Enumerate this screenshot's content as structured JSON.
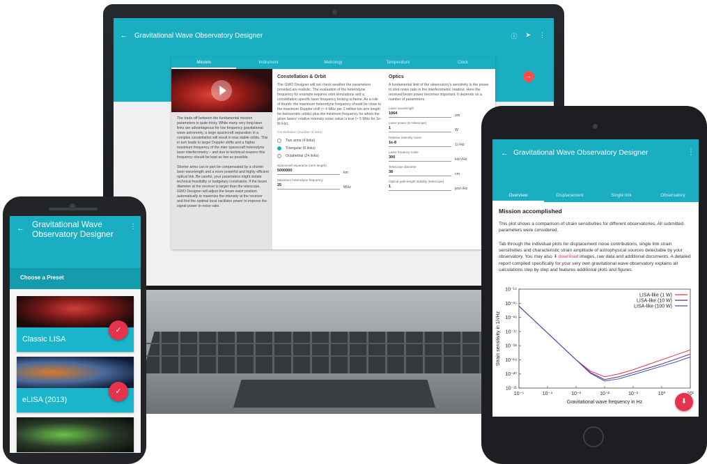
{
  "app": {
    "title": "Gravitational Wave Observatory Designer"
  },
  "laptop": {
    "tabs": [
      "Mission",
      "Instrument",
      "Metrology",
      "Temperature",
      "Clock"
    ],
    "active_tab": "Mission",
    "left_text": "The trade-off between the fundamental mission parameters is quite tricky. While many very long laser links are advantageous for low frequency gravitational wave astronomy, a large spacecraft separation in a complex constellation will result in less stable orbits. This in turn leads to larger Doppler shifts and a higher maximum frequency of the inter spacecraft heterodyne laser interferometry – and due to technical reasons this frequency should be kept as low as possible.\n\nShorter arms can in part be compensated by a shorter laser wavelength and a more powerful and highly efficient optical link. Be careful, your parameters might violate technical feasibility or budgetary constraints. If the beam diameter at the receiver is larger than the telescope, GWO Designer will adjust the beam waist position automatically to maximize the intensity at the receiver and find the optimal local oscillator power to improve the signal power to noise ratio.",
    "constellation": {
      "heading": "Constellation & Orbit",
      "text": "The GWO Designer will not check weather the parameters provided are realistic. The evaluation of the heterodyne frequency for example requires orbit simulations and a constellation specific laser frequency locking scheme. As a rule of thumb: the maximum heterodyne frequency should be close to the maximum Doppler shift (≈ 4 MHz per 1 million km arm length for heliocentric orbits) plus the minimum frequency for which the given lasers' relative intensity noise value is true (≈ 5 MHz for 1e-8/√Hz).",
      "options_label": "Constellation (number of links)",
      "options": [
        "Two arms (4 links)",
        "Triangular (6 links)",
        "Octahedral (24 links)"
      ],
      "selected": "Triangular (6 links)",
      "fields": [
        {
          "label": "Spacecraft separation (arm length)",
          "value": "5000000",
          "unit": "km"
        },
        {
          "label": "Maximum heterodyne frequency",
          "value": "25",
          "unit": "MHz"
        }
      ]
    },
    "optics": {
      "heading": "Optics",
      "text": "A fundamental limit of the observatory's sensitivity is the power to shot noise ratio in the interferometric readout. Here the received beam power becomes important. It depends on a number of parameters.",
      "fields": [
        {
          "label": "Laser wavelength",
          "value": "1064",
          "unit": "nm"
        },
        {
          "label": "Laser power (to telescope)",
          "value": "1",
          "unit": "W"
        },
        {
          "label": "Relative intensity noise",
          "value": "1e-8",
          "unit": "1/√Hz"
        },
        {
          "label": "Laser freuency noise",
          "value": "300",
          "unit": "Hz/√Hz"
        },
        {
          "label": "Telescope diameter",
          "value": "38",
          "unit": "cm"
        },
        {
          "label": "Optical path-length stability (telescope)",
          "value": "1",
          "unit": "pm/√Hz"
        }
      ]
    },
    "icons": {
      "back": "arrow-left-icon",
      "info": "info-icon",
      "share": "share-icon",
      "menu": "more-vert-icon",
      "next": "arrow-right-icon"
    }
  },
  "phone": {
    "title": "Gravitational Wave Observatory Designer",
    "section": "Choose a Preset",
    "presets": [
      "Classic LISA",
      "eLISA (2013)"
    ]
  },
  "tablet": {
    "tabs": [
      "Overview",
      "Displacement",
      "Single link",
      "Observatory"
    ],
    "active_tab": "Overview",
    "heading": "Mission accomplished",
    "para1": "This plot shows a comparison of strain sensitivities for different observatories. All submitted parameters were considered.",
    "para2_a": "Tab through the individual plots for displacement noise contributions, single link strain sensitivities and characteristic strain amplitude of astrophysical sources detectable by your observatory. You may also ",
    "para2_link": "⬇ download",
    "para2_b": " images, raw data and additional documents. A detailed report compiled specifically for your very own gravitational wave observatory explains all calculations step by step and features additional plots and figures."
  },
  "chart_data": {
    "type": "line",
    "xlabel": "Gravitational wave frequency in Hz",
    "ylabel": "Strain sensitivity in 1/√Hz",
    "x_scale": "log",
    "y_scale": "log",
    "xlim_exp": [
      -5,
      1
    ],
    "ylim_exp": [
      -21,
      -14
    ],
    "x_tick_labels": [
      "10⁻⁵",
      "10⁻⁴",
      "10⁻³",
      "10⁻²",
      "10⁻¹",
      "10⁰",
      "10¹"
    ],
    "y_tick_labels": [
      "10⁻²¹",
      "10⁻²⁰",
      "10⁻¹⁹",
      "10⁻¹⁸",
      "10⁻¹⁷",
      "10⁻¹⁶",
      "10⁻¹⁵",
      "10⁻¹⁴"
    ],
    "legend_position": "top-right",
    "x_log10": [
      -5,
      -4,
      -3,
      -2.5,
      -2,
      -1.5,
      -1,
      -0.5,
      0,
      0.5,
      1
    ],
    "series": [
      {
        "name": "LISA-like (1 W)",
        "color": "#e6334b",
        "y_log10": [
          -15.2,
          -17.1,
          -19.0,
          -19.8,
          -20.2,
          -20.0,
          -19.7,
          -19.35,
          -19.0,
          -18.65,
          -18.3
        ]
      },
      {
        "name": "LISA-like (10 W)",
        "color": "#5a2d7a",
        "y_log10": [
          -15.2,
          -17.1,
          -19.0,
          -19.9,
          -20.4,
          -20.2,
          -19.9,
          -19.6,
          -19.3,
          -18.95,
          -18.6
        ]
      },
      {
        "name": "LISA-like (100 W)",
        "color": "#3f51b5",
        "y_log10": [
          -15.2,
          -17.1,
          -19.0,
          -19.95,
          -20.5,
          -20.35,
          -20.05,
          -19.75,
          -19.45,
          -19.15,
          -18.8
        ]
      }
    ]
  }
}
